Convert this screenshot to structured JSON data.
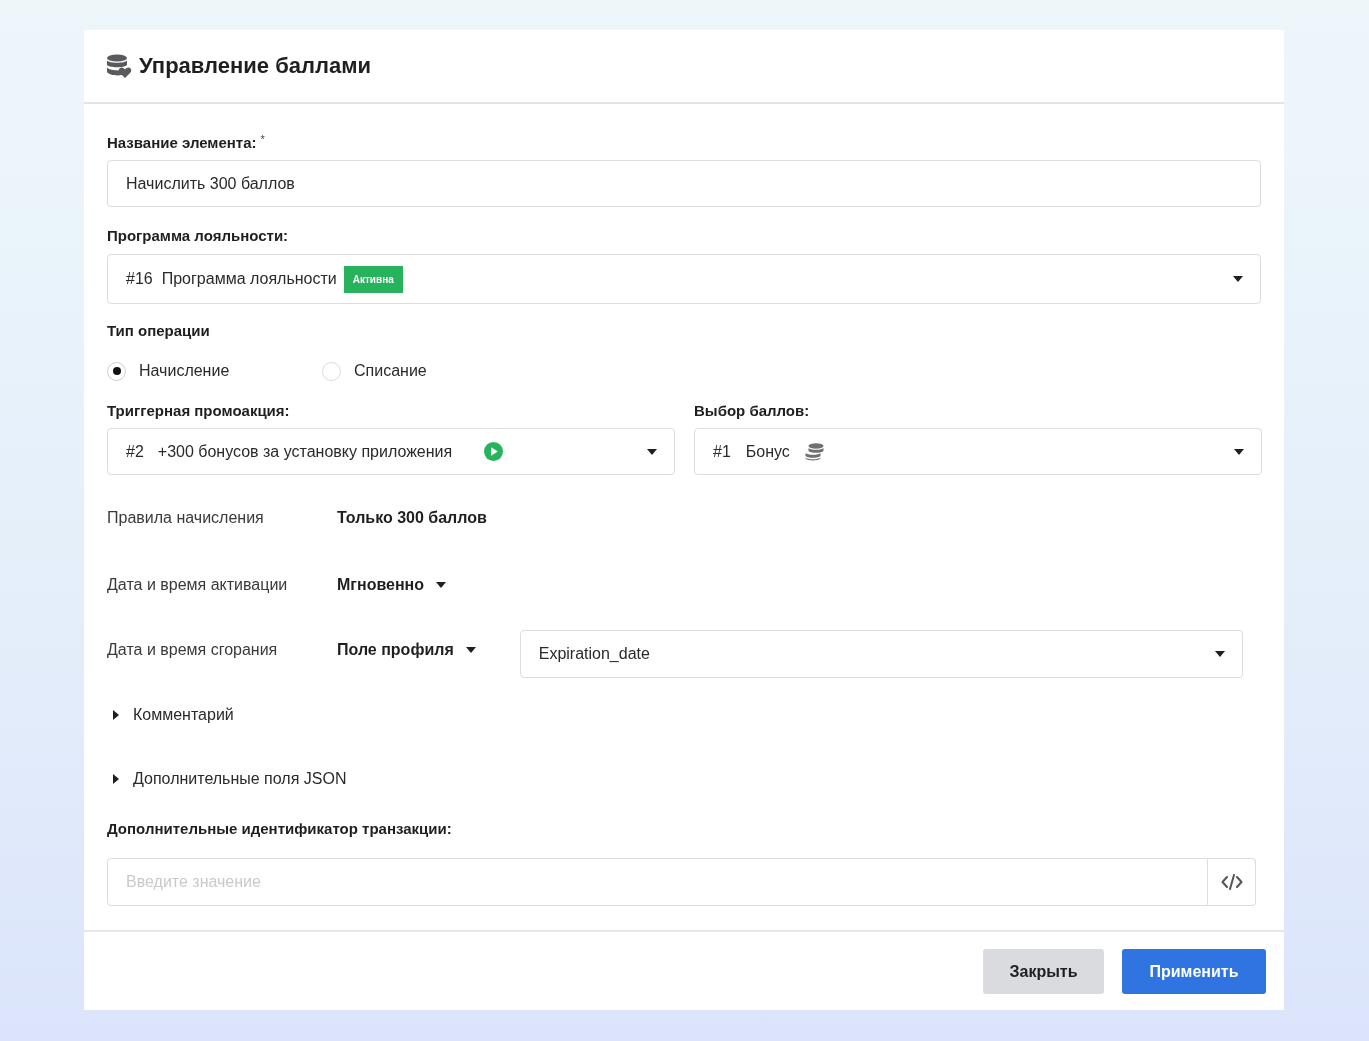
{
  "header": {
    "title": "Управление баллами"
  },
  "form": {
    "name_field": {
      "label": "Название элемента:",
      "required_mark": "*",
      "value": "Начислить 300 баллов"
    },
    "program_select": {
      "label": "Программа лояльности:",
      "number": "#16",
      "value": "Программа лояльности",
      "badge": "Активна"
    },
    "operation_type": {
      "label": "Тип операции",
      "options": [
        {
          "label": "Начисление",
          "selected": true
        },
        {
          "label": "Списание",
          "selected": false
        }
      ]
    },
    "trigger_select": {
      "label": "Триггерная промоакция:",
      "number": "#2",
      "value": "+300 бонусов за установку приложения"
    },
    "points_select": {
      "label": "Выбор баллов:",
      "number": "#1",
      "value": "Бонус"
    },
    "settings": [
      {
        "kind": "text",
        "label": "Правила начисления",
        "value": "Только 300 баллов"
      },
      {
        "kind": "dropdown",
        "label": "Дата и время активации",
        "value": "Мгновенно"
      },
      {
        "kind": "dropdown_field",
        "label": "Дата и время сгорания",
        "value": "Поле профиля",
        "field_value": "Expiration_date"
      }
    ],
    "sections": [
      {
        "label": "Комментарий",
        "expanded": false
      },
      {
        "label": "Дополнительные поля JSON",
        "expanded": false
      }
    ],
    "transaction_field": {
      "label": "Дополнительные идентификатор транзакции:",
      "placeholder": "Введите значение"
    }
  },
  "buttons": [
    {
      "kind": "secondary",
      "label": "Закрыть"
    },
    {
      "kind": "primary",
      "label": "Применить"
    }
  ]
}
